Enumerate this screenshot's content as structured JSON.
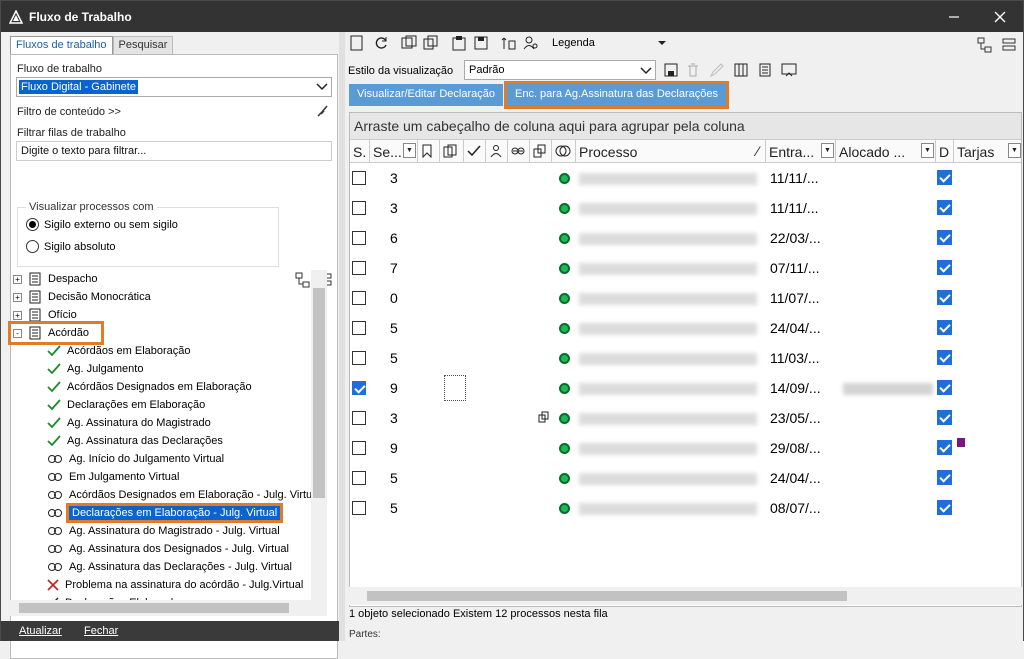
{
  "window": {
    "title": "Fluxo de Trabalho"
  },
  "left": {
    "tabs": [
      {
        "label": "Fluxos de trabalho",
        "active": true
      },
      {
        "label": "Pesquisar",
        "active": false
      }
    ],
    "fluxo_label": "Fluxo de trabalho",
    "fluxo_value": "Fluxo Digital - Gabinete",
    "filtro_conteudo": "Filtro de conteúdo >>",
    "filtrar_label": "Filtrar filas de trabalho",
    "filtrar_placeholder": "Digite o texto para filtrar...",
    "visualizar_title": "Visualizar processos com",
    "radio1": "Sigilo externo ou sem sigilo",
    "radio2": "Sigilo absoluto",
    "tree": [
      {
        "label": "Despacho",
        "icon": "document-icon",
        "level": 0,
        "expander": "+"
      },
      {
        "label": "Decisão Monocrática",
        "icon": "document-icon",
        "level": 0,
        "expander": "+"
      },
      {
        "label": "Ofício",
        "icon": "document-icon",
        "level": 0,
        "expander": "+"
      },
      {
        "label": "Acórdão",
        "icon": "document-icon",
        "level": 0,
        "expander": "-"
      },
      {
        "label": "Acórdãos em Elaboração",
        "icon": "check-icon",
        "level": 1
      },
      {
        "label": "Ag. Julgamento",
        "icon": "check-icon",
        "level": 1
      },
      {
        "label": "Acórdãos Designados em Elaboração",
        "icon": "check-icon",
        "level": 1
      },
      {
        "label": "Declarações em Elaboração",
        "icon": "check-icon",
        "level": 1
      },
      {
        "label": "Ag. Assinatura do Magistrado",
        "icon": "check-icon",
        "level": 1
      },
      {
        "label": "Ag. Assinatura das Declarações",
        "icon": "check-icon",
        "level": 1
      },
      {
        "label": "Ag. Início do Julgamento Virtual",
        "icon": "link-icon",
        "level": 1
      },
      {
        "label": "Em Julgamento Virtual",
        "icon": "link-icon",
        "level": 1
      },
      {
        "label": "Acórdãos Designados em Elaboração - Julg. Virtual",
        "icon": "link-icon",
        "level": 1
      },
      {
        "label": "Declarações em Elaboração - Julg. Virtual",
        "icon": "link-icon",
        "level": 1,
        "selected": true
      },
      {
        "label": "Ag. Assinatura do Magistrado - Julg. Virtual",
        "icon": "link-icon",
        "level": 1
      },
      {
        "label": "Ag. Assinatura dos Designados - Julg. Virtual",
        "icon": "link-icon",
        "level": 1
      },
      {
        "label": "Ag. Assinatura das Declarações - Julg. Virtual",
        "icon": "link-icon",
        "level": 1
      },
      {
        "label": "Problema na assinatura do acórdão - Julg.Virtual",
        "icon": "x-icon",
        "level": 1
      },
      {
        "label": "Declarações Elaboradas",
        "icon": "pen-icon",
        "level": 1
      }
    ],
    "atualizar": "Atualizar",
    "fechar": "Fechar"
  },
  "right": {
    "legenda": "Legenda",
    "estilo_label": "Estilo da visualização",
    "estilo_value": "Padrão",
    "btn1": "Visualizar/Editar Declaração",
    "btn2": "Enc. para Ag.Assinatura das Declarações",
    "group_hint": "Arraste um cabeçalho de coluna aqui para agrupar pela coluna",
    "columns": {
      "s": "S.",
      "seq": "Se...",
      "processo": "Processo",
      "entrada": "Entra...",
      "alocado": "Alocado ...",
      "d": "D",
      "tarjas": "Tarjas"
    },
    "rows": [
      {
        "checked": false,
        "seq": "3",
        "entrada": "11/11/..."
      },
      {
        "checked": false,
        "seq": "3",
        "entrada": "11/11/..."
      },
      {
        "checked": false,
        "seq": "6",
        "entrada": "22/03/..."
      },
      {
        "checked": false,
        "seq": "7",
        "entrada": "07/11/..."
      },
      {
        "checked": false,
        "seq": "0",
        "entrada": "11/07/..."
      },
      {
        "checked": false,
        "seq": "5",
        "entrada": "24/04/..."
      },
      {
        "checked": false,
        "seq": "5",
        "entrada": "11/03/..."
      },
      {
        "checked": true,
        "seq": "9",
        "entrada": "14/09/..."
      },
      {
        "checked": false,
        "seq": "3",
        "entrada": "23/05/..."
      },
      {
        "checked": false,
        "seq": "9",
        "entrada": "29/08/..."
      },
      {
        "checked": false,
        "seq": "5",
        "entrada": "24/04/..."
      },
      {
        "checked": false,
        "seq": "5",
        "entrada": "08/07/..."
      }
    ],
    "status": "1 objeto selecionado  Existem 12 processos nesta fila",
    "partes": "Partes:"
  },
  "colors": {
    "accent": "#5b9bd5",
    "highlight": "#e07b28",
    "check": "#1e6fd9",
    "status_dot": "#1db954"
  }
}
